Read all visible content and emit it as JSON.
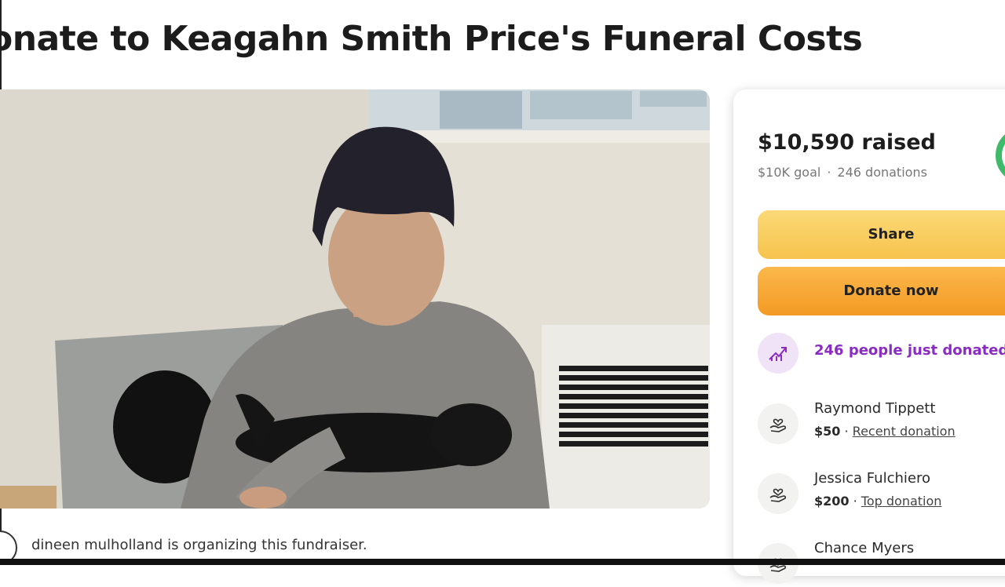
{
  "campaign": {
    "title": "onate to Keagahn Smith Price's Funeral Costs",
    "organizer_text": "dineen mulholland is organizing this fundraiser."
  },
  "donation": {
    "raised": "$10,590 raised",
    "goal": "$10K goal",
    "separator": "·",
    "donations_count": "246 donations",
    "progress_fraction": 1.0,
    "share_label": "Share",
    "donate_label": "Donate now",
    "trend_text": "246 people just donated"
  },
  "donors": [
    {
      "name": "Raymond Tippett",
      "amount": "$50",
      "sep": " · ",
      "tag": "Recent donation"
    },
    {
      "name": "Jessica Fulchiero",
      "amount": "$200",
      "sep": " · ",
      "tag": "Top donation"
    },
    {
      "name": "Chance Myers",
      "amount": "",
      "sep": "",
      "tag": ""
    }
  ],
  "colors": {
    "accent_green": "#3fb96a",
    "share_yellow": "#f6c34d",
    "donate_orange": "#f39a23",
    "trend_purple": "#8a2bc4"
  },
  "icons": {
    "trend": "trending-up-icon",
    "donor": "heart-hand-icon"
  }
}
